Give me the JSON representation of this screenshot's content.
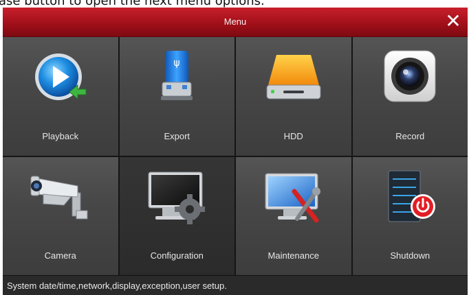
{
  "caption": "ase button to open the next menu options.",
  "window": {
    "title": "Menu",
    "close_icon": "close-icon",
    "accent": "#b5141f"
  },
  "tiles": [
    {
      "label": "Playback",
      "icon": "playback-icon"
    },
    {
      "label": "Export",
      "icon": "usb-drive-icon"
    },
    {
      "label": "HDD",
      "icon": "hard-drive-icon"
    },
    {
      "label": "Record",
      "icon": "record-camera-icon"
    },
    {
      "label": "Camera",
      "icon": "cctv-camera-icon"
    },
    {
      "label": "Configuration",
      "icon": "monitor-gear-icon"
    },
    {
      "label": "Maintenance",
      "icon": "monitor-tools-icon"
    },
    {
      "label": "Shutdown",
      "icon": "server-power-icon"
    }
  ],
  "active_tile": "Configuration",
  "status": {
    "text": "System date/time,network,display,exception,user setup."
  }
}
